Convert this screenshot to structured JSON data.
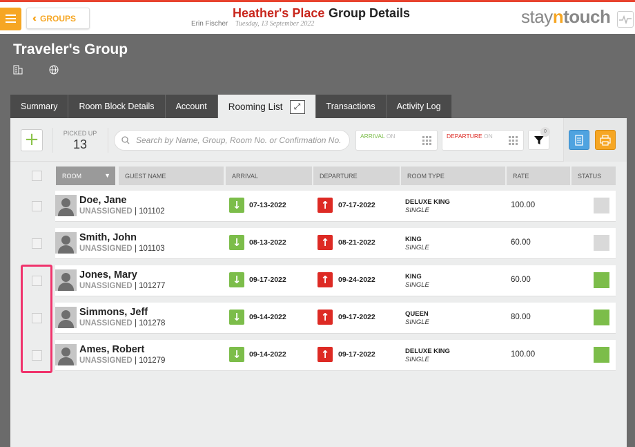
{
  "header": {
    "back_label": "GROUPS",
    "hotel_name": "Heather's Place",
    "page_title": "Group Details",
    "user_name": "Erin Fischer",
    "date": "Tuesday, 13 September 2022",
    "logo": {
      "part1": "stay",
      "part2": "n",
      "part3": "touch"
    }
  },
  "group": {
    "title": "Traveler's Group"
  },
  "tabs": [
    {
      "label": "Summary"
    },
    {
      "label": "Room Block Details"
    },
    {
      "label": "Account"
    },
    {
      "label": "Rooming List",
      "active": true
    },
    {
      "label": "Transactions"
    },
    {
      "label": "Activity Log"
    }
  ],
  "toolbar": {
    "picked_up_label": "PICKED UP",
    "picked_up_value": "13",
    "search_placeholder": "Search by Name, Group, Room No. or Confirmation No.",
    "arrival_label": "ARRIVAL",
    "arrival_state": "ON",
    "departure_label": "DEPARTURE",
    "departure_state": "ON",
    "filter_count": "0"
  },
  "columns": {
    "room": "ROOM",
    "guest_name": "GUEST NAME",
    "arrival": "ARRIVAL",
    "departure": "DEPARTURE",
    "room_type": "ROOM TYPE",
    "rate": "RATE",
    "status": "STATUS"
  },
  "rows": [
    {
      "guest": "Doe, Jane",
      "room": "UNASSIGNED",
      "confirmation": "101102",
      "arrival": "07-13-2022",
      "departure": "07-17-2022",
      "room_type": "DELUXE KING",
      "occupancy": "SINGLE",
      "rate": "100.00",
      "status_color": "#d9d9d9"
    },
    {
      "guest": "Smith, John",
      "room": "UNASSIGNED",
      "confirmation": "101103",
      "arrival": "08-13-2022",
      "departure": "08-21-2022",
      "room_type": "KING",
      "occupancy": "SINGLE",
      "rate": "60.00",
      "status_color": "#d9d9d9"
    },
    {
      "guest": "Jones, Mary",
      "room": "UNASSIGNED",
      "confirmation": "101277",
      "arrival": "09-17-2022",
      "departure": "09-24-2022",
      "room_type": "KING",
      "occupancy": "SINGLE",
      "rate": "60.00",
      "status_color": "#7cbd4a"
    },
    {
      "guest": "Simmons, Jeff",
      "room": "UNASSIGNED",
      "confirmation": "101278",
      "arrival": "09-14-2022",
      "departure": "09-17-2022",
      "room_type": "QUEEN",
      "occupancy": "SINGLE",
      "rate": "80.00",
      "status_color": "#7cbd4a"
    },
    {
      "guest": "Ames, Robert",
      "room": "UNASSIGNED",
      "confirmation": "101279",
      "arrival": "09-14-2022",
      "departure": "09-17-2022",
      "room_type": "DELUXE KING",
      "occupancy": "SINGLE",
      "rate": "100.00",
      "status_color": "#7cbd4a"
    }
  ],
  "colors": {
    "accent_orange": "#f6a623",
    "brand_red": "#c8261c",
    "arrival_green": "#7cbd4a",
    "departure_red": "#dd2a24",
    "highlight_pink": "#f0336c"
  }
}
